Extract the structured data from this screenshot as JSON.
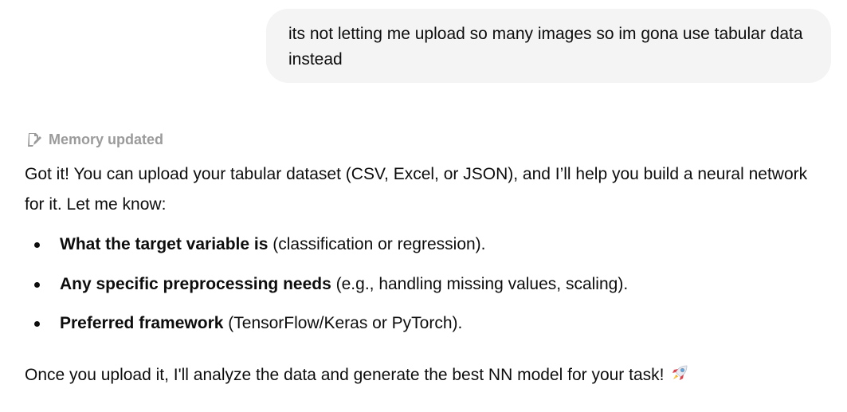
{
  "user_message": {
    "text": "its not letting me upload so many images so im gona use tabular data instead"
  },
  "memory": {
    "icon": "memory-edit-icon",
    "label": "Memory updated"
  },
  "assistant": {
    "intro": "Got it! You can upload your tabular dataset (CSV, Excel, or JSON), and I’ll help you build a neural network for it. Let me know:",
    "bullets": [
      {
        "bold": "What the target variable is",
        "rest": " (classification or regression)."
      },
      {
        "bold": "Any specific preprocessing needs",
        "rest": " (e.g., handling missing values, scaling)."
      },
      {
        "bold": "Preferred framework",
        "rest": " (TensorFlow/Keras or PyTorch)."
      }
    ],
    "closing": "Once you upload it, I'll analyze the data and generate the best NN model for your task!",
    "closing_emoji": "rocket-icon"
  },
  "colors": {
    "bubble_bg": "#f4f4f4",
    "memory_text": "#9b9b9b",
    "body_text": "#0d0d0d"
  }
}
